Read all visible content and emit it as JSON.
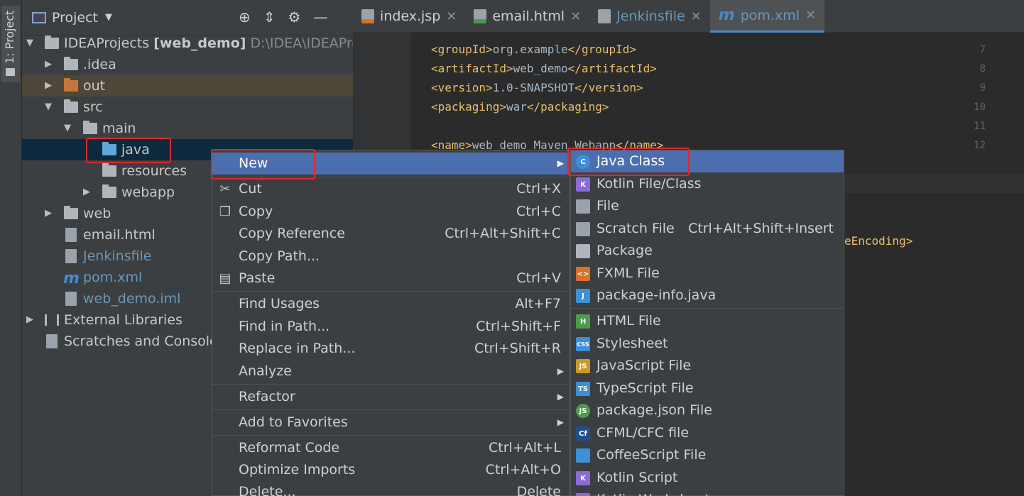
{
  "left_strip": {
    "label": "1: Project"
  },
  "panel": {
    "title": "Project"
  },
  "tree": [
    {
      "label": "IDEAProjects",
      "bold": "[web_demo]",
      "path": "D:\\IDEA\\IDEAProjec"
    },
    {
      "label": ".idea"
    },
    {
      "label": "out"
    },
    {
      "label": "src"
    },
    {
      "label": "main"
    },
    {
      "label": "java"
    },
    {
      "label": "resources"
    },
    {
      "label": "webapp"
    },
    {
      "label": "web"
    },
    {
      "label": "email.html"
    },
    {
      "label": "Jenkinsfile"
    },
    {
      "label": "pom.xml"
    },
    {
      "label": "web_demo.iml"
    },
    {
      "label": "External Libraries"
    },
    {
      "label": "Scratches and Consoles"
    }
  ],
  "tabs": [
    {
      "label": "index.jsp",
      "icon": "jsp-file-icon"
    },
    {
      "label": "email.html",
      "icon": "html-file-icon"
    },
    {
      "label": "Jenkinsfile",
      "icon": "file-icon"
    },
    {
      "label": "pom.xml",
      "icon": "maven-icon"
    }
  ],
  "editor": {
    "lines": [
      {
        "num": "7",
        "open": "<groupId>",
        "text": "org.example",
        "close": "</groupId>"
      },
      {
        "num": "8",
        "open": "<artifactId>",
        "text": "web_demo",
        "close": "</artifactId>"
      },
      {
        "num": "9",
        "open": "<version>",
        "text": "1.0-SNAPSHOT",
        "close": "</version>"
      },
      {
        "num": "10",
        "open": "<packaging>",
        "text": "war",
        "close": "</packaging>"
      },
      {
        "num": "11"
      },
      {
        "num": "12",
        "open": "<name>",
        "text": "web_demo Maven Webapp",
        "close": "</name>"
      }
    ],
    "right_fragment": "eEncoding>"
  },
  "context_menu": [
    {
      "label": "New",
      "shortcut": "",
      "submenu": true
    },
    {
      "label": "Cut",
      "shortcut": "Ctrl+X"
    },
    {
      "label": "Copy",
      "shortcut": "Ctrl+C"
    },
    {
      "label": "Copy Reference",
      "shortcut": "Ctrl+Alt+Shift+C"
    },
    {
      "label": "Copy Path...",
      "shortcut": ""
    },
    {
      "label": "Paste",
      "shortcut": "Ctrl+V"
    },
    {
      "label": "Find Usages",
      "shortcut": "Alt+F7"
    },
    {
      "label": "Find in Path...",
      "shortcut": "Ctrl+Shift+F"
    },
    {
      "label": "Replace in Path...",
      "shortcut": "Ctrl+Shift+R"
    },
    {
      "label": "Analyze",
      "shortcut": "",
      "submenu": true
    },
    {
      "label": "Refactor",
      "shortcut": "",
      "submenu": true
    },
    {
      "label": "Add to Favorites",
      "shortcut": "",
      "submenu": true
    },
    {
      "label": "Reformat Code",
      "shortcut": "Ctrl+Alt+L"
    },
    {
      "label": "Optimize Imports",
      "shortcut": "Ctrl+Alt+O"
    },
    {
      "label": "Delete...",
      "shortcut": "Delete"
    }
  ],
  "new_submenu": [
    {
      "label": "Java Class",
      "shortcut": "",
      "icon_text": "C",
      "color": "#3d8fd6"
    },
    {
      "label": "Kotlin File/Class",
      "shortcut": "",
      "icon_text": "K",
      "color": "#8a6bd8"
    },
    {
      "label": "File",
      "shortcut": "",
      "icon_text": "",
      "color": "#9aa3ab"
    },
    {
      "label": "Scratch File",
      "shortcut": "Ctrl+Alt+Shift+Insert",
      "icon_text": "",
      "color": "#9aa3ab"
    },
    {
      "label": "Package",
      "shortcut": "",
      "icon_text": "",
      "color": "#aeb5bb"
    },
    {
      "label": "FXML File",
      "shortcut": "",
      "icon_text": "<>",
      "color": "#d9712b"
    },
    {
      "label": "package-info.java",
      "shortcut": "",
      "icon_text": "J",
      "color": "#3d8fd6"
    },
    {
      "label": "HTML File",
      "shortcut": "",
      "icon_text": "H",
      "color": "#4e9a4e"
    },
    {
      "label": "Stylesheet",
      "shortcut": "",
      "icon_text": "CSS",
      "color": "#3d8fd6"
    },
    {
      "label": "JavaScript File",
      "shortcut": "",
      "icon_text": "JS",
      "color": "#c89a2a"
    },
    {
      "label": "TypeScript File",
      "shortcut": "",
      "icon_text": "TS",
      "color": "#3d8fd6"
    },
    {
      "label": "package.json File",
      "shortcut": "",
      "icon_text": "JS",
      "color": "#4e9a4e"
    },
    {
      "label": "CFML/CFC file",
      "shortcut": "",
      "icon_text": "Cf",
      "color": "#1f4f8a"
    },
    {
      "label": "CoffeeScript File",
      "shortcut": "",
      "icon_text": "",
      "color": "#3d8fd6"
    },
    {
      "label": "Kotlin Script",
      "shortcut": "",
      "icon_text": "K",
      "color": "#8a6bd8"
    },
    {
      "label": "Kotlin Worksheet",
      "shortcut": "",
      "icon_text": "K",
      "color": "#8a6bd8"
    }
  ]
}
